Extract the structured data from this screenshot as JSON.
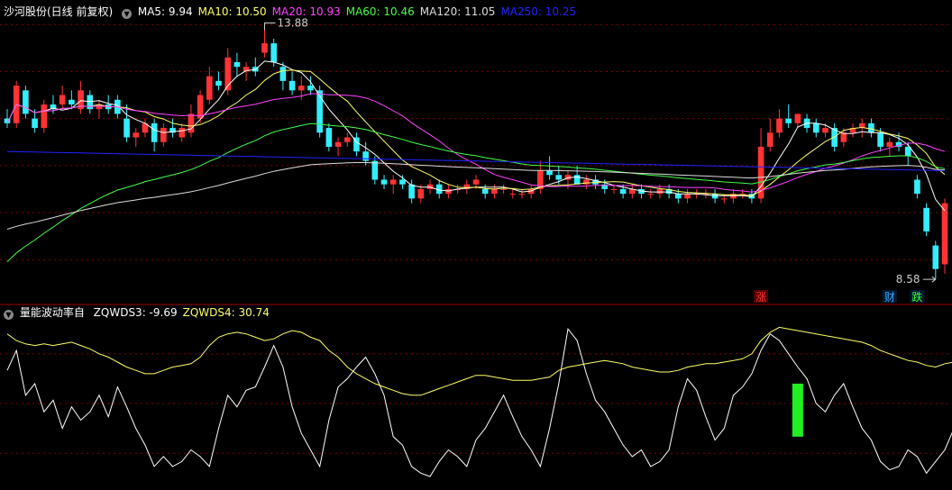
{
  "header": {
    "stock_title": "沙河股份(日线 前复权)",
    "ma_items": [
      {
        "label": "MA5: 9.94",
        "color": "#ffffff"
      },
      {
        "label": "MA10: 10.50",
        "color": "#ffff66"
      },
      {
        "label": "MA20: 10.93",
        "color": "#ff44ff"
      },
      {
        "label": "MA60: 10.46",
        "color": "#44ff44"
      },
      {
        "label": "MA120: 11.05",
        "color": "#dddddd"
      },
      {
        "label": "MA250: 10.25",
        "color": "#2222ff"
      }
    ]
  },
  "indicator_header": {
    "title": "量能波动率自",
    "items": [
      {
        "label": "ZQWDS3: -9.69",
        "color": "#ffffff"
      },
      {
        "label": "ZQWDS4: 30.74",
        "color": "#ffff66"
      }
    ]
  },
  "colors": {
    "up": "#ff3333",
    "down": "#33eeff",
    "grid": "#8b0000",
    "ma5": "#ffffff",
    "ma10": "#ffff66",
    "ma20": "#ff44ff",
    "ma60": "#44ff44",
    "ma120": "#dddddd",
    "ma250": "#2222ff",
    "bar": "#22ee22"
  },
  "chart_data": [
    {
      "type": "candlestick",
      "ylim": [
        8.2,
        14.1
      ],
      "high_annotation": {
        "label": "13.88",
        "value": 13.88,
        "index": 28
      },
      "low_annotation": {
        "label": "8.58",
        "value": 8.58,
        "index": 101
      },
      "markers": [
        {
          "label": "涨",
          "index": 82,
          "color": "#ff3333"
        },
        {
          "label": "财",
          "index": 96,
          "color": "#33aaff"
        },
        {
          "label": "跌",
          "index": 99,
          "color": "#33ff33"
        }
      ],
      "candles": [
        [
          12.0,
          12.2,
          11.8,
          11.9
        ],
        [
          11.9,
          12.8,
          11.8,
          12.7
        ],
        [
          12.6,
          12.7,
          12.0,
          12.1
        ],
        [
          12.0,
          12.2,
          11.7,
          11.8
        ],
        [
          11.8,
          12.4,
          11.7,
          12.3
        ],
        [
          12.3,
          12.5,
          12.1,
          12.2
        ],
        [
          12.3,
          12.7,
          12.2,
          12.5
        ],
        [
          12.4,
          12.6,
          12.2,
          12.3
        ],
        [
          12.2,
          12.8,
          12.1,
          12.6
        ],
        [
          12.5,
          12.6,
          12.1,
          12.2
        ],
        [
          12.2,
          12.4,
          12.0,
          12.3
        ],
        [
          12.3,
          12.5,
          12.1,
          12.2
        ],
        [
          12.4,
          12.5,
          12.0,
          12.1
        ],
        [
          12.0,
          12.3,
          11.5,
          11.6
        ],
        [
          11.6,
          11.8,
          11.4,
          11.7
        ],
        [
          11.7,
          12.0,
          11.6,
          11.9
        ],
        [
          11.9,
          12.0,
          11.3,
          11.5
        ],
        [
          11.5,
          11.9,
          11.4,
          11.8
        ],
        [
          11.8,
          12.0,
          11.6,
          11.7
        ],
        [
          11.6,
          11.9,
          11.5,
          11.8
        ],
        [
          11.7,
          12.3,
          11.6,
          12.1
        ],
        [
          12.0,
          12.6,
          11.9,
          12.5
        ],
        [
          12.4,
          13.1,
          12.3,
          12.9
        ],
        [
          12.8,
          13.0,
          12.6,
          12.7
        ],
        [
          12.6,
          13.5,
          12.5,
          13.3
        ],
        [
          13.2,
          13.4,
          12.9,
          13.1
        ],
        [
          13.0,
          13.2,
          12.8,
          13.1
        ],
        [
          13.1,
          13.3,
          12.9,
          13.0
        ],
        [
          13.4,
          13.88,
          13.3,
          13.6
        ],
        [
          13.6,
          13.7,
          13.1,
          13.2
        ],
        [
          13.1,
          13.2,
          12.6,
          12.8
        ],
        [
          12.8,
          13.0,
          12.5,
          12.6
        ],
        [
          12.6,
          12.9,
          12.4,
          12.7
        ],
        [
          12.7,
          12.9,
          12.5,
          12.6
        ],
        [
          12.6,
          12.7,
          11.6,
          11.7
        ],
        [
          11.8,
          11.9,
          11.3,
          11.4
        ],
        [
          11.4,
          11.6,
          11.2,
          11.5
        ],
        [
          11.5,
          11.7,
          11.4,
          11.6
        ],
        [
          11.6,
          11.7,
          11.2,
          11.3
        ],
        [
          11.3,
          11.5,
          11.0,
          11.1
        ],
        [
          11.1,
          11.2,
          10.6,
          10.7
        ],
        [
          10.7,
          10.8,
          10.5,
          10.6
        ],
        [
          10.6,
          10.8,
          10.4,
          10.7
        ],
        [
          10.7,
          10.8,
          10.5,
          10.6
        ],
        [
          10.6,
          10.7,
          10.2,
          10.3
        ],
        [
          10.3,
          10.6,
          10.2,
          10.5
        ],
        [
          10.5,
          10.7,
          10.4,
          10.6
        ],
        [
          10.6,
          10.7,
          10.3,
          10.4
        ],
        [
          10.4,
          10.6,
          10.3,
          10.5
        ],
        [
          10.5,
          10.6,
          10.4,
          10.5
        ],
        [
          10.5,
          10.7,
          10.4,
          10.6
        ],
        [
          10.6,
          10.8,
          10.5,
          10.7
        ],
        [
          10.5,
          10.6,
          10.3,
          10.4
        ],
        [
          10.4,
          10.6,
          10.3,
          10.5
        ],
        [
          10.5,
          10.6,
          10.4,
          10.5
        ],
        [
          10.4,
          10.5,
          10.3,
          10.4
        ],
        [
          10.4,
          10.5,
          10.3,
          10.4
        ],
        [
          10.4,
          10.6,
          10.3,
          10.5
        ],
        [
          10.5,
          11.1,
          10.4,
          10.9
        ],
        [
          10.9,
          11.2,
          10.7,
          10.8
        ],
        [
          10.8,
          11.0,
          10.6,
          10.7
        ],
        [
          10.7,
          10.9,
          10.5,
          10.8
        ],
        [
          10.8,
          11.0,
          10.6,
          10.6
        ],
        [
          10.6,
          10.8,
          10.5,
          10.7
        ],
        [
          10.7,
          10.8,
          10.5,
          10.6
        ],
        [
          10.6,
          10.7,
          10.4,
          10.5
        ],
        [
          10.5,
          10.6,
          10.4,
          10.5
        ],
        [
          10.5,
          10.6,
          10.3,
          10.4
        ],
        [
          10.4,
          10.6,
          10.3,
          10.5
        ],
        [
          10.5,
          10.6,
          10.3,
          10.4
        ],
        [
          10.4,
          10.5,
          10.3,
          10.4
        ],
        [
          10.4,
          10.6,
          10.3,
          10.5
        ],
        [
          10.5,
          10.6,
          10.3,
          10.4
        ],
        [
          10.4,
          10.5,
          10.2,
          10.3
        ],
        [
          10.3,
          10.5,
          10.2,
          10.4
        ],
        [
          10.4,
          10.5,
          10.3,
          10.4
        ],
        [
          10.4,
          10.5,
          10.3,
          10.4
        ],
        [
          10.4,
          10.5,
          10.2,
          10.3
        ],
        [
          10.3,
          10.4,
          10.2,
          10.3
        ],
        [
          10.3,
          10.5,
          10.2,
          10.4
        ],
        [
          10.4,
          10.5,
          10.3,
          10.4
        ],
        [
          10.4,
          10.5,
          10.2,
          10.3
        ],
        [
          10.3,
          11.8,
          10.2,
          11.4
        ],
        [
          11.4,
          12.0,
          11.3,
          11.7
        ],
        [
          11.7,
          12.2,
          11.6,
          12.0
        ],
        [
          12.0,
          12.3,
          11.8,
          11.9
        ],
        [
          11.9,
          12.1,
          11.8,
          12.1
        ],
        [
          12.0,
          12.1,
          11.7,
          11.8
        ],
        [
          11.9,
          12.0,
          11.6,
          11.7
        ],
        [
          11.7,
          11.9,
          11.6,
          11.8
        ],
        [
          11.8,
          11.9,
          11.3,
          11.4
        ],
        [
          11.5,
          11.8,
          11.4,
          11.7
        ],
        [
          11.7,
          11.9,
          11.6,
          11.8
        ],
        [
          11.8,
          12.0,
          11.6,
          11.9
        ],
        [
          11.9,
          12.0,
          11.6,
          11.7
        ],
        [
          11.7,
          11.8,
          11.3,
          11.4
        ],
        [
          11.4,
          11.6,
          11.2,
          11.5
        ],
        [
          11.5,
          11.7,
          11.3,
          11.4
        ],
        [
          11.4,
          11.5,
          11.0,
          11.2
        ],
        [
          10.7,
          10.8,
          10.3,
          10.4
        ],
        [
          10.1,
          10.2,
          9.5,
          9.6
        ],
        [
          9.3,
          9.4,
          8.58,
          8.8
        ],
        [
          8.9,
          10.3,
          8.7,
          10.2
        ]
      ]
    },
    {
      "type": "line",
      "ylim": [
        0,
        100
      ],
      "series": [
        {
          "name": "ZQWDS3",
          "color": "#ffffff",
          "values": [
            70,
            82,
            55,
            62,
            45,
            52,
            35,
            48,
            40,
            45,
            55,
            42,
            60,
            48,
            35,
            25,
            12,
            18,
            12,
            15,
            22,
            18,
            12,
            35,
            55,
            48,
            58,
            60,
            72,
            85,
            72,
            48,
            32,
            22,
            12,
            40,
            60,
            65,
            72,
            78,
            68,
            55,
            30,
            25,
            12,
            8,
            6,
            15,
            22,
            18,
            12,
            28,
            35,
            45,
            55,
            42,
            30,
            22,
            12,
            35,
            62,
            95,
            88,
            68,
            52,
            45,
            35,
            25,
            18,
            22,
            12,
            15,
            22,
            48,
            65,
            58,
            42,
            28,
            35,
            55,
            60,
            68,
            82,
            92,
            88,
            80,
            72,
            65,
            50,
            45,
            55,
            62,
            48,
            35,
            28,
            15,
            10,
            12,
            22,
            18,
            8,
            15,
            22,
            35,
            42
          ]
        },
        {
          "name": "ZQWDS4",
          "color": "#ffff66",
          "values": [
            92,
            88,
            86,
            85,
            86,
            85,
            86,
            87,
            85,
            83,
            80,
            78,
            75,
            72,
            70,
            68,
            68,
            70,
            72,
            73,
            74,
            78,
            85,
            90,
            92,
            93,
            92,
            90,
            88,
            89,
            92,
            94,
            93,
            90,
            88,
            82,
            78,
            72,
            68,
            65,
            62,
            60,
            58,
            56,
            55,
            55,
            57,
            59,
            61,
            63,
            65,
            67,
            67,
            66,
            65,
            64,
            64,
            64,
            65,
            66,
            70,
            72,
            73,
            74,
            75,
            76,
            75,
            74,
            72,
            71,
            70,
            69,
            69,
            70,
            72,
            73,
            74,
            74,
            75,
            76,
            77,
            80,
            88,
            93,
            96,
            95,
            94,
            93,
            92,
            91,
            90,
            89,
            88,
            87,
            85,
            82,
            80,
            78,
            76,
            75,
            73,
            72,
            74,
            75,
            77
          ]
        }
      ],
      "bars": [
        {
          "index": 86,
          "from": 30,
          "to": 62,
          "color": "#22ee22"
        }
      ]
    }
  ]
}
